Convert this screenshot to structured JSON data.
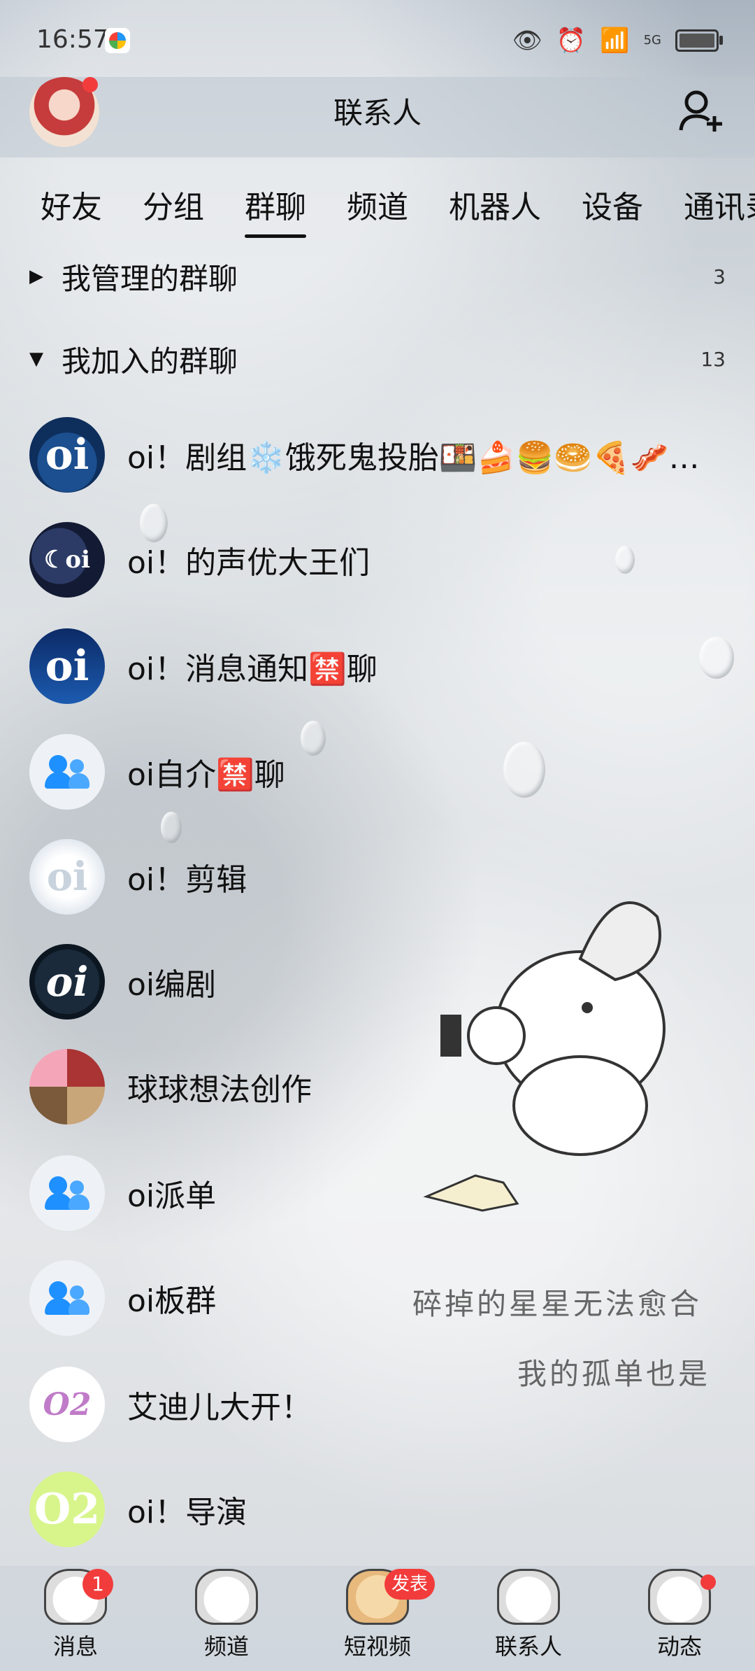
{
  "status_bar": {
    "time": "16:57",
    "network": "5G"
  },
  "header": {
    "title": "联系人"
  },
  "tabs": [
    "好友",
    "分组",
    "群聊",
    "频道",
    "机器人",
    "设备",
    "通讯录"
  ],
  "sections": {
    "managed": {
      "label": "我管理的群聊",
      "count": "3"
    },
    "joined": {
      "label": "我加入的群聊",
      "count": "13"
    }
  },
  "groups": [
    {
      "name": "oi！剧组❄️饿死鬼投胎🍱🍰🍔🥯🍕🥓…",
      "avatar": "oi"
    },
    {
      "name": "oi！的声优大王们",
      "avatar": "oi"
    },
    {
      "name": "oi！消息通知🈲聊",
      "avatar": "oi"
    },
    {
      "name": "oi自介🈲聊",
      "avatar": "default"
    },
    {
      "name": "oi！剪辑",
      "avatar": "oi"
    },
    {
      "name": "oi编剧",
      "avatar": "oi"
    },
    {
      "name": "球球想法创作",
      "avatar": "collage"
    },
    {
      "name": "oi派单",
      "avatar": "default"
    },
    {
      "name": "oi板群",
      "avatar": "default"
    },
    {
      "name": "艾迪儿大开！",
      "avatar": "O2"
    },
    {
      "name": "oi！导演",
      "avatar": "O2"
    }
  ],
  "wallpaper_text": [
    "碎掉的星星无法愈合",
    "我的孤单也是"
  ],
  "bottom_nav": [
    {
      "label": "消息",
      "badge": "1"
    },
    {
      "label": "频道"
    },
    {
      "label": "短视频",
      "badge": "发表"
    },
    {
      "label": "联系人"
    },
    {
      "label": "动态",
      "dot": true
    }
  ],
  "colors": {
    "accent_red": "#f23c3c",
    "group_icon_blue": "#1e90ff"
  }
}
